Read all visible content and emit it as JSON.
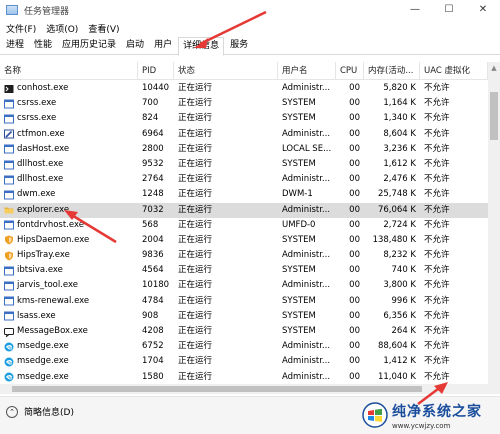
{
  "window": {
    "title": "任务管理器",
    "minimize": "—",
    "maximize": "☐",
    "close": "✕"
  },
  "menu": [
    "文件(F)",
    "选项(O)",
    "查看(V)"
  ],
  "tabs": [
    "进程",
    "性能",
    "应用历史记录",
    "启动",
    "用户",
    "详细信息",
    "服务"
  ],
  "active_tab": "详细信息",
  "columns": {
    "name": "名称",
    "pid": "PID",
    "status": "状态",
    "user": "用户名",
    "cpu": "CPU",
    "mem": "内存(活动...",
    "uac": "UAC 虚拟化"
  },
  "rows": [
    {
      "name": "conhost.exe",
      "pid": "10440",
      "status": "正在运行",
      "user": "Administr...",
      "cpu": "00",
      "mem": "5,820 K",
      "uac": "不允许",
      "icon": "console-icon",
      "color": "#1f1f1f"
    },
    {
      "name": "csrss.exe",
      "pid": "700",
      "status": "正在运行",
      "user": "SYSTEM",
      "cpu": "00",
      "mem": "1,164 K",
      "uac": "不允许",
      "icon": "window-icon",
      "color": "#3b6fc4"
    },
    {
      "name": "csrss.exe",
      "pid": "824",
      "status": "正在运行",
      "user": "SYSTEM",
      "cpu": "00",
      "mem": "1,340 K",
      "uac": "不允许",
      "icon": "window-icon",
      "color": "#3b6fc4"
    },
    {
      "name": "ctfmon.exe",
      "pid": "6964",
      "status": "正在运行",
      "user": "Administr...",
      "cpu": "00",
      "mem": "8,604 K",
      "uac": "不允许",
      "icon": "pen-icon",
      "color": "#2d4f9e"
    },
    {
      "name": "dasHost.exe",
      "pid": "2800",
      "status": "正在运行",
      "user": "LOCAL SE...",
      "cpu": "00",
      "mem": "3,236 K",
      "uac": "不允许",
      "icon": "window-icon",
      "color": "#3b6fc4"
    },
    {
      "name": "dllhost.exe",
      "pid": "9532",
      "status": "正在运行",
      "user": "SYSTEM",
      "cpu": "00",
      "mem": "1,612 K",
      "uac": "不允许",
      "icon": "window-icon",
      "color": "#3b6fc4"
    },
    {
      "name": "dllhost.exe",
      "pid": "2764",
      "status": "正在运行",
      "user": "Administr...",
      "cpu": "00",
      "mem": "2,476 K",
      "uac": "不允许",
      "icon": "window-icon",
      "color": "#3b6fc4"
    },
    {
      "name": "dwm.exe",
      "pid": "1248",
      "status": "正在运行",
      "user": "DWM-1",
      "cpu": "00",
      "mem": "25,748 K",
      "uac": "不允许",
      "icon": "window-icon",
      "color": "#3b6fc4"
    },
    {
      "name": "explorer.exe",
      "pid": "7032",
      "status": "正在运行",
      "user": "Administr...",
      "cpu": "00",
      "mem": "76,064 K",
      "uac": "不允许",
      "icon": "folder-icon",
      "color": "#e8b13a"
    },
    {
      "name": "fontdrvhost.exe",
      "pid": "568",
      "status": "正在运行",
      "user": "UMFD-0",
      "cpu": "00",
      "mem": "2,724 K",
      "uac": "不允许",
      "icon": "window-icon",
      "color": "#3b6fc4"
    },
    {
      "name": "HipsDaemon.exe",
      "pid": "2004",
      "status": "正在运行",
      "user": "SYSTEM",
      "cpu": "00",
      "mem": "138,480 K",
      "uac": "不允许",
      "icon": "shield-icon",
      "color": "#f0a020"
    },
    {
      "name": "HipsTray.exe",
      "pid": "9836",
      "status": "正在运行",
      "user": "Administr...",
      "cpu": "00",
      "mem": "8,232 K",
      "uac": "不允许",
      "icon": "shield-icon",
      "color": "#f0a020"
    },
    {
      "name": "ibtsiva.exe",
      "pid": "4564",
      "status": "正在运行",
      "user": "SYSTEM",
      "cpu": "00",
      "mem": "740 K",
      "uac": "不允许",
      "icon": "window-icon",
      "color": "#3b6fc4"
    },
    {
      "name": "jarvis_tool.exe",
      "pid": "10180",
      "status": "正在运行",
      "user": "Administr...",
      "cpu": "00",
      "mem": "3,800 K",
      "uac": "不允许",
      "icon": "window-icon",
      "color": "#3b6fc4"
    },
    {
      "name": "kms-renewal.exe",
      "pid": "4784",
      "status": "正在运行",
      "user": "SYSTEM",
      "cpu": "00",
      "mem": "996 K",
      "uac": "不允许",
      "icon": "window-icon",
      "color": "#3b6fc4"
    },
    {
      "name": "lsass.exe",
      "pid": "908",
      "status": "正在运行",
      "user": "SYSTEM",
      "cpu": "00",
      "mem": "6,356 K",
      "uac": "不允许",
      "icon": "window-icon",
      "color": "#3b6fc4"
    },
    {
      "name": "MessageBox.exe",
      "pid": "4208",
      "status": "正在运行",
      "user": "SYSTEM",
      "cpu": "00",
      "mem": "264 K",
      "uac": "不允许",
      "icon": "message-icon",
      "color": "#1f1f1f"
    },
    {
      "name": "msedge.exe",
      "pid": "6752",
      "status": "正在运行",
      "user": "Administr...",
      "cpu": "00",
      "mem": "88,604 K",
      "uac": "不允许",
      "icon": "edge-icon",
      "color": "#1b9de2"
    },
    {
      "name": "msedge.exe",
      "pid": "1704",
      "status": "正在运行",
      "user": "Administr...",
      "cpu": "00",
      "mem": "1,412 K",
      "uac": "不允许",
      "icon": "edge-icon",
      "color": "#1b9de2"
    },
    {
      "name": "msedge.exe",
      "pid": "1580",
      "status": "正在运行",
      "user": "Administr...",
      "cpu": "00",
      "mem": "11,040 K",
      "uac": "不允许",
      "icon": "edge-icon",
      "color": "#1b9de2"
    }
  ],
  "selected_row": 8,
  "footer": {
    "fewer_details": "简略信息(D)"
  },
  "watermark": {
    "main": "纯净系统之家",
    "sub": "www.ycwjzy.com"
  },
  "accent": {
    "arrow": "#e53935",
    "selection": "#dcdcdc"
  }
}
